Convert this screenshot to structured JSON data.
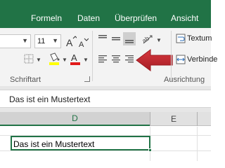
{
  "tabs": [
    "Formeln",
    "Daten",
    "Überprüfen",
    "Ansicht"
  ],
  "font": {
    "size": "11"
  },
  "group_labels": {
    "font": "Schriftart",
    "alignment": "Ausrichtung"
  },
  "alignment_buttons": {
    "wrap_text": "Textum",
    "merge": "Verbinde"
  },
  "colors": {
    "ribbon_green": "#217346",
    "arrow_red": "#c4262e",
    "font_color_red": "#e21b1b",
    "highlight_yellow": "#ffff00"
  },
  "formula_bar": {
    "content": "Das ist ein Mustertext"
  },
  "columns": [
    "D",
    "E"
  ],
  "cell": {
    "value": "Das ist ein Mustertext"
  },
  "annotation": {
    "arrow_icon": "red-arrow-left"
  }
}
